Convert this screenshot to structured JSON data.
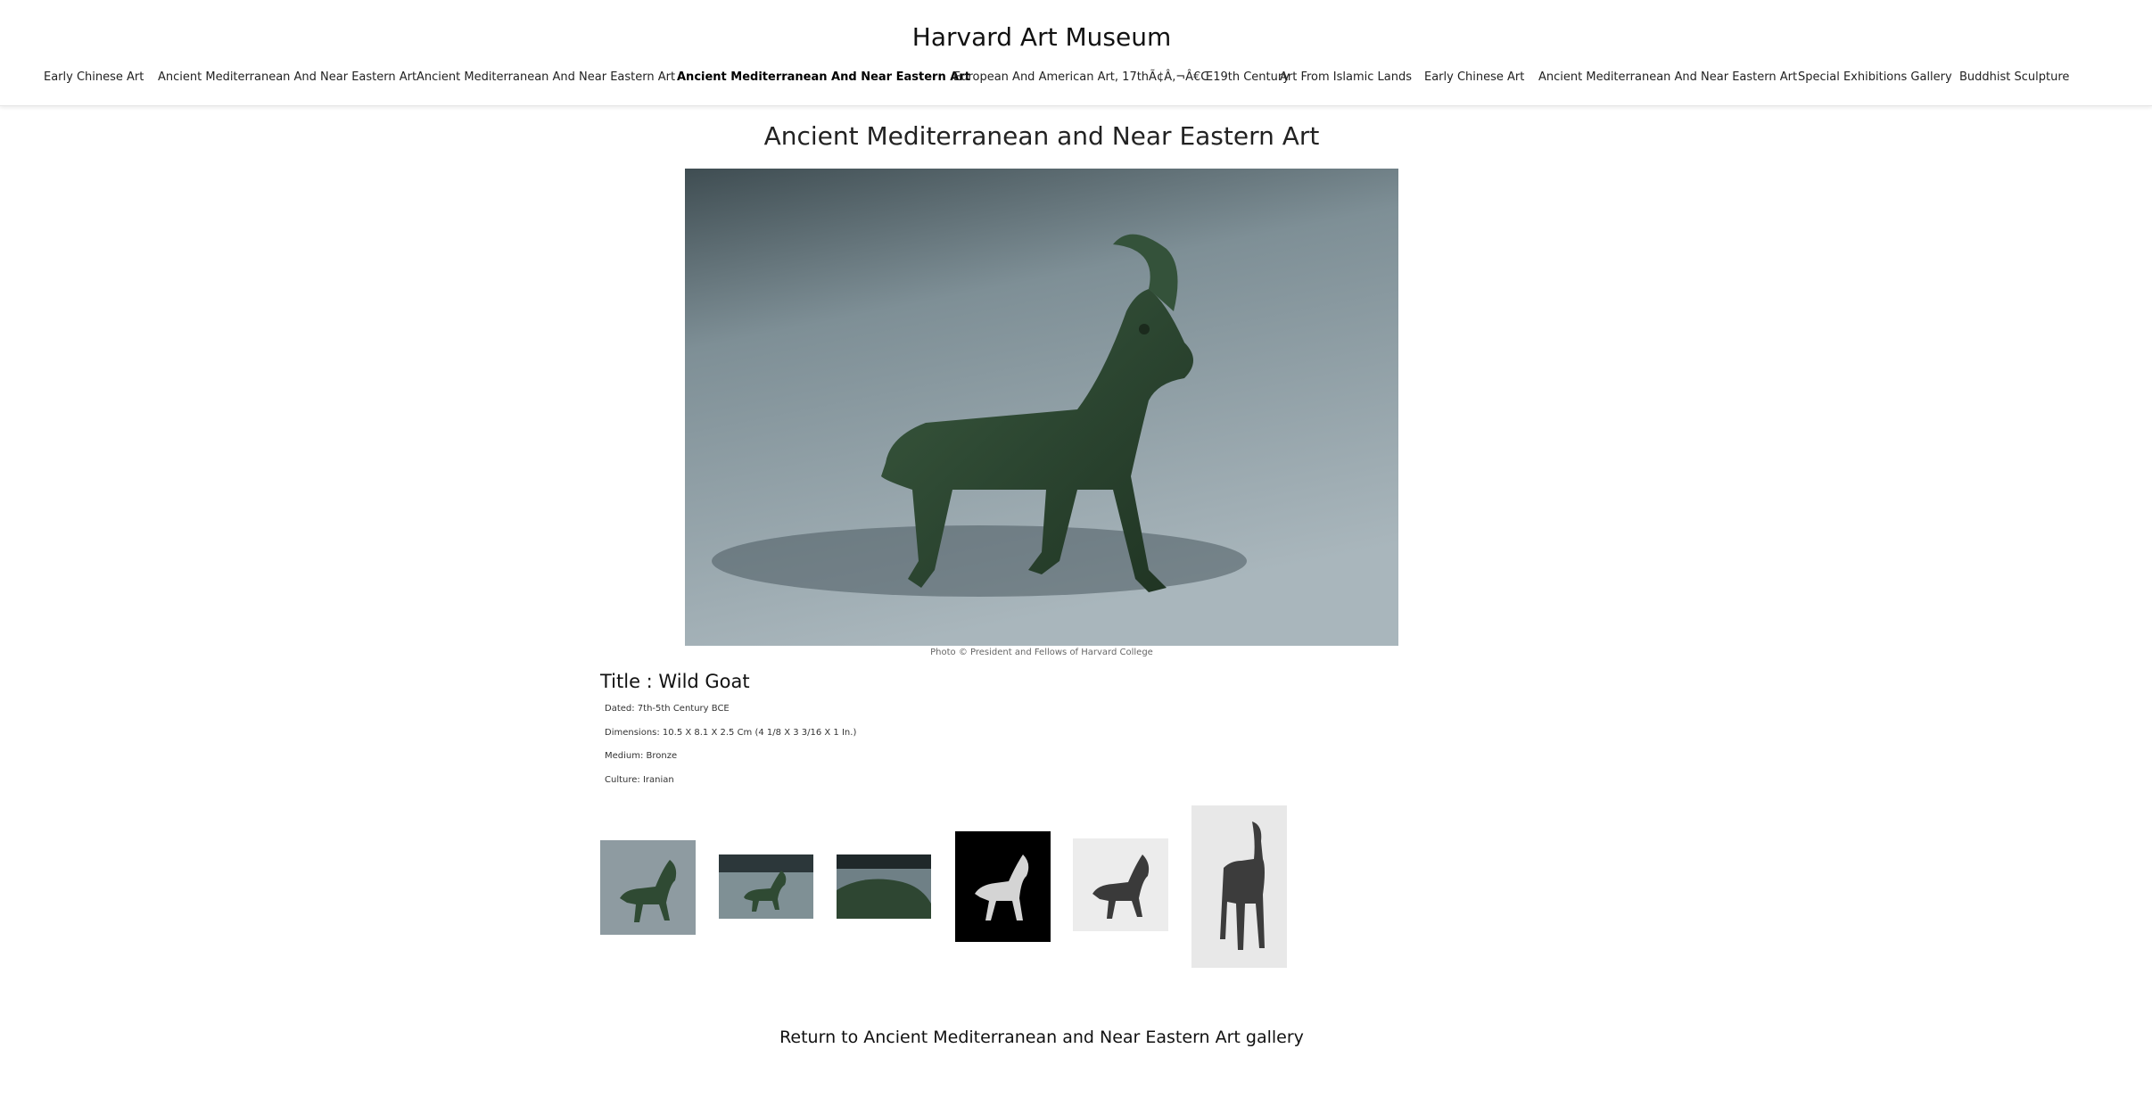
{
  "site": {
    "title": "Harvard Art Museum"
  },
  "nav": {
    "items": [
      {
        "label": "Early Chinese Art",
        "active": false
      },
      {
        "label": "Ancient Mediterranean And Near Eastern Art",
        "active": false
      },
      {
        "label": "Ancient Mediterranean And Near Eastern Art",
        "active": false
      },
      {
        "label": "Ancient Mediterranean And Near Eastern Art",
        "active": true
      },
      {
        "label": "European And American Art, 17thÃ¢Â‚¬Â€Œ19th Century",
        "active": false
      },
      {
        "label": "Art From Islamic Lands",
        "active": false
      },
      {
        "label": "Early Chinese Art",
        "active": false
      },
      {
        "label": "Ancient Mediterranean And Near Eastern Art",
        "active": false
      },
      {
        "label": "Special Exhibitions Gallery",
        "active": false
      },
      {
        "label": "Buddhist Sculpture",
        "active": false
      }
    ]
  },
  "page": {
    "title": "Ancient Mediterranean and Near Eastern Art"
  },
  "image": {
    "caption": "Photo © President and Fellows of Harvard College"
  },
  "object": {
    "title": "Title : Wild Goat",
    "dated": "Dated: 7th-5th Century BCE",
    "dimensions": "Dimensions: 10.5 X 8.1 X 2.5 Cm (4 1/8 X 3 3/16 X 1 In.)",
    "medium": "Medium: Bronze",
    "culture": "Culture: Iranian"
  },
  "thumbnails": [
    {
      "name": "thumbnail-1"
    },
    {
      "name": "thumbnail-2"
    },
    {
      "name": "thumbnail-3"
    },
    {
      "name": "thumbnail-4"
    },
    {
      "name": "thumbnail-5"
    },
    {
      "name": "thumbnail-6"
    }
  ],
  "footer": {
    "return_label": "Return to Ancient Mediterranean and Near Eastern Art gallery"
  }
}
